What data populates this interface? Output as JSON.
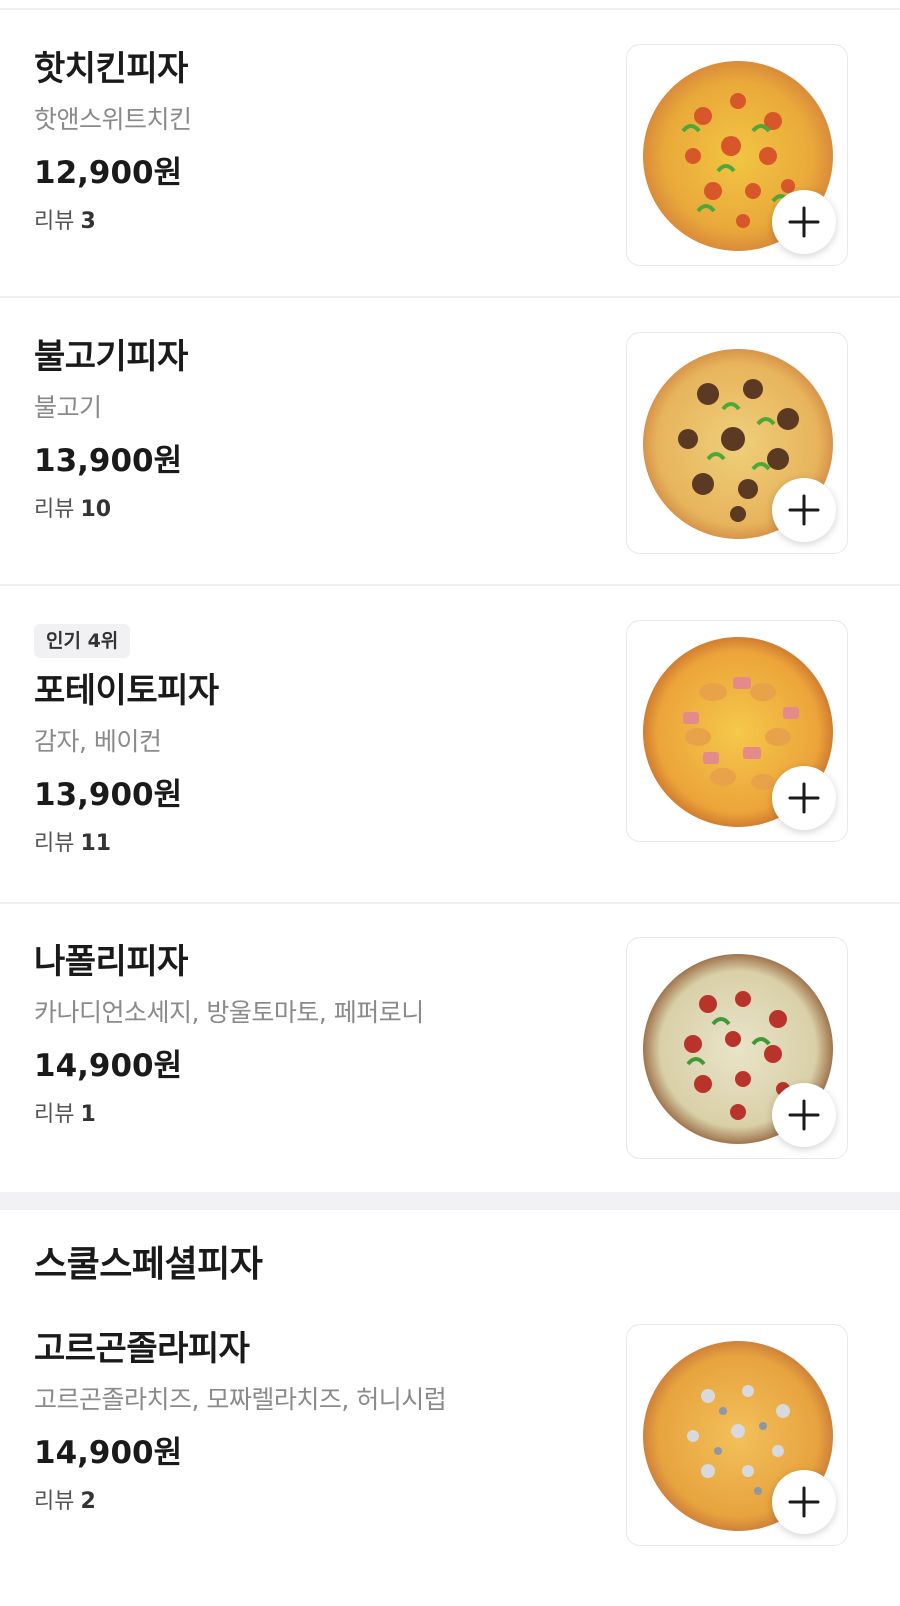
{
  "items": [
    {
      "name": "핫치킨피자",
      "desc": "핫앤스위트치킨",
      "price": "12,900원",
      "review_label": "리뷰",
      "review_count": "3",
      "image": "hot-chicken-pizza"
    },
    {
      "name": "불고기피자",
      "desc": "불고기",
      "price": "13,900원",
      "review_label": "리뷰",
      "review_count": "10",
      "image": "bulgogi-pizza"
    },
    {
      "badge": "인기 4위",
      "name": "포테이토피자",
      "desc": "감자, 베이컨",
      "price": "13,900원",
      "review_label": "리뷰",
      "review_count": "11",
      "image": "potato-pizza"
    },
    {
      "name": "나폴리피자",
      "desc": "카나디언소세지, 방울토마토, 페퍼로니",
      "price": "14,900원",
      "review_label": "리뷰",
      "review_count": "1",
      "image": "napoli-pizza"
    }
  ],
  "section": {
    "title": "스쿨스페셜피자",
    "items": [
      {
        "name": "고르곤졸라피자",
        "desc": "고르곤졸라치즈, 모짜렐라치즈, 허니시럽",
        "price": "14,900원",
        "review_label": "리뷰",
        "review_count": "2",
        "image": "gorgonzola-pizza"
      }
    ]
  },
  "icons": {
    "add": "plus-icon"
  },
  "colors": {
    "divider": "#f0f0f0",
    "section_gap": "#f2f2f4",
    "badge_bg": "#f1f1f3"
  }
}
